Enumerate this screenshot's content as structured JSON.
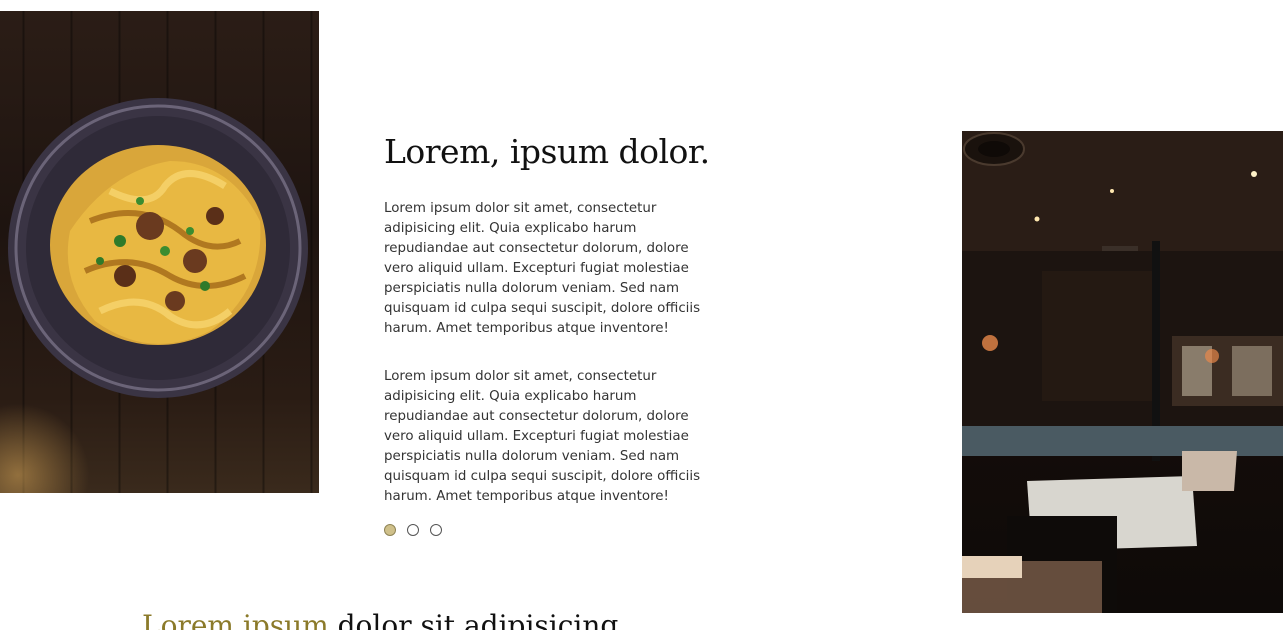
{
  "hero": {
    "heading": "Lorem, ipsum dolor.",
    "paragraphs": [
      "Lorem ipsum dolor sit amet, consectetur adipisicing elit. Quia explicabo harum repudiandae aut consectetur dolorum, dolore vero aliquid ullam. Excepturi fugiat molestiae perspiciatis nulla dolorum veniam. Sed nam quisquam id culpa sequi suscipit, dolore officiis harum. Amet temporibus atque inventore!",
      "Lorem ipsum dolor sit amet, consectetur adipisicing elit. Quia explicabo harum repudiandae aut consectetur dolorum, dolore vero aliquid ullam. Excepturi fugiat molestiae perspiciatis nulla dolorum veniam. Sed nam quisquam id culpa sequi suscipit, dolore officiis harum. Amet temporibus atque inventore!"
    ],
    "carousel": {
      "total": 3,
      "active_index": 0,
      "active_color": "#cfc08a"
    }
  },
  "images": {
    "left": "pasta-dish-photo",
    "right": "restaurant-interior-photo"
  },
  "section": {
    "heading_accent": "Lorem ipsum",
    "heading_rest": " dolor sit adipisicing",
    "accent_color": "#8b7a2a"
  }
}
